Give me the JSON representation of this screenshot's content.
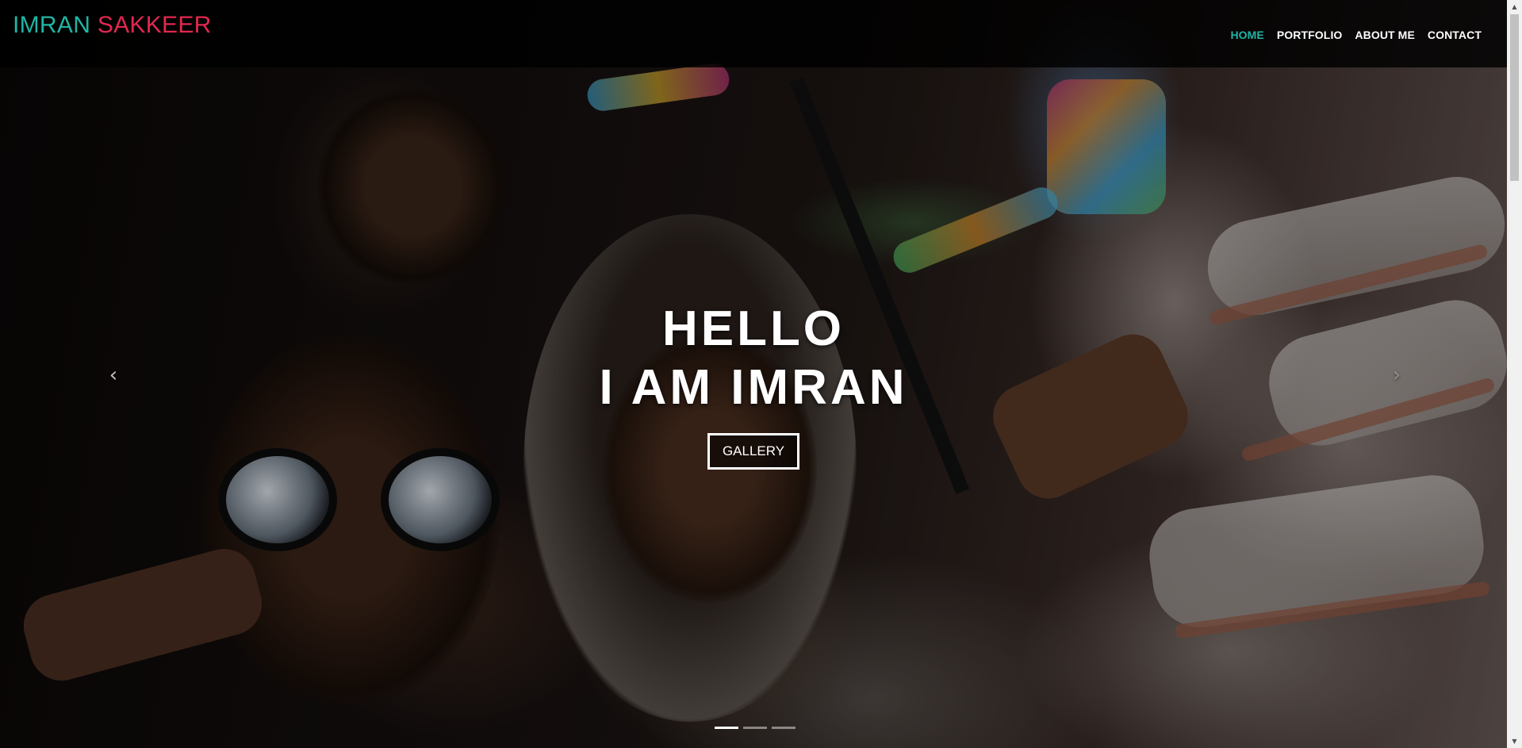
{
  "brand": {
    "first": "IMRAN",
    "last": "SAKKEER"
  },
  "nav": {
    "items": [
      {
        "label": "HOME",
        "active": true
      },
      {
        "label": "PORTFOLIO",
        "active": false
      },
      {
        "label": "ABOUT ME",
        "active": false
      },
      {
        "label": "CONTACT",
        "active": false
      }
    ]
  },
  "hero": {
    "heading_line1": "HELLO",
    "heading_line2": "I AM IMRAN",
    "button_label": "GALLERY",
    "prev_icon": "chevron-left-icon",
    "next_icon": "chevron-right-icon",
    "slides_count": 3,
    "active_slide": 1
  },
  "colors": {
    "brand_first": "#1fb5a6",
    "brand_last": "#e0284f",
    "nav_active": "#1fb5a6",
    "nav_text": "#ffffff",
    "navbar_bg": "#000000"
  }
}
